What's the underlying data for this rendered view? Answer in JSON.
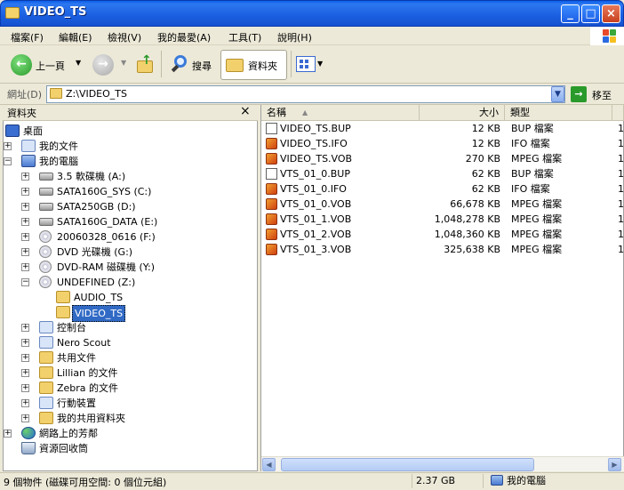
{
  "window": {
    "title": "VIDEO_TS"
  },
  "menu": [
    "檔案(F)",
    "編輯(E)",
    "檢視(V)",
    "我的最愛(A)",
    "工具(T)",
    "說明(H)"
  ],
  "toolbar": {
    "back_label": "上一頁",
    "search_label": "搜尋",
    "folders_label": "資料夾"
  },
  "address": {
    "label": "網址(D)",
    "value": "Z:\\VIDEO_TS",
    "go_label": "移至"
  },
  "left_pane": {
    "title": "資料夾",
    "close": "×"
  },
  "tree": [
    {
      "label": "桌面",
      "icon": "desktop-icon",
      "expander": ""
    },
    {
      "label": "我的文件",
      "icon": "my-documents-icon",
      "expander": "+"
    },
    {
      "label": "我的電腦",
      "icon": "my-computer-icon",
      "expander": "−"
    },
    {
      "label": "3.5 軟碟機 (A:)",
      "icon": "floppy-drive-icon",
      "expander": "+"
    },
    {
      "label": "SATA160G_SYS (C:)",
      "icon": "hard-drive-icon",
      "expander": "+"
    },
    {
      "label": "SATA250GB (D:)",
      "icon": "hard-drive-icon",
      "expander": "+"
    },
    {
      "label": "SATA160G_DATA (E:)",
      "icon": "hard-drive-icon",
      "expander": "+"
    },
    {
      "label": "20060328_0616 (F:)",
      "icon": "cd-drive-icon",
      "expander": "+"
    },
    {
      "label": "DVD 光碟機 (G:)",
      "icon": "dvd-drive-icon",
      "expander": "+"
    },
    {
      "label": "DVD-RAM 磁碟機 (Y:)",
      "icon": "dvd-ram-drive-icon",
      "expander": "+"
    },
    {
      "label": "UNDEFINED (Z:)",
      "icon": "dvd-disc-icon",
      "expander": "−"
    },
    {
      "label": "AUDIO_TS",
      "icon": "folder-icon",
      "expander": ""
    },
    {
      "label": "VIDEO_TS",
      "icon": "folder-open-icon",
      "expander": ""
    },
    {
      "label": "控制台",
      "icon": "control-panel-icon",
      "expander": "+"
    },
    {
      "label": "Nero Scout",
      "icon": "nero-scout-icon",
      "expander": "+"
    },
    {
      "label": "共用文件",
      "icon": "folder-icon",
      "expander": "+"
    },
    {
      "label": "Lillian 的文件",
      "icon": "folder-icon",
      "expander": "+"
    },
    {
      "label": "Zebra 的文件",
      "icon": "folder-icon",
      "expander": "+"
    },
    {
      "label": "行動裝置",
      "icon": "mobile-device-icon",
      "expander": "+"
    },
    {
      "label": "我的共用資料夾",
      "icon": "shared-folder-icon",
      "expander": "+"
    },
    {
      "label": "網路上的芳鄰",
      "icon": "network-icon",
      "expander": "+"
    },
    {
      "label": "資源回收筒",
      "icon": "recycle-bin-icon",
      "expander": ""
    }
  ],
  "columns": {
    "name": "名稱",
    "sort": "▲",
    "size": "大小",
    "type": "類型"
  },
  "files": [
    {
      "name": "VIDEO_TS.BUP",
      "size": "12 KB",
      "type": "BUP 檔案",
      "kind": "bup",
      "extra": "1"
    },
    {
      "name": "VIDEO_TS.IFO",
      "size": "12 KB",
      "type": "IFO 檔案",
      "kind": "vob",
      "extra": "1"
    },
    {
      "name": "VIDEO_TS.VOB",
      "size": "270 KB",
      "type": "MPEG 檔案",
      "kind": "vob",
      "extra": "1"
    },
    {
      "name": "VTS_01_0.BUP",
      "size": "62 KB",
      "type": "BUP 檔案",
      "kind": "bup",
      "extra": "1"
    },
    {
      "name": "VTS_01_0.IFO",
      "size": "62 KB",
      "type": "IFO 檔案",
      "kind": "vob",
      "extra": "1"
    },
    {
      "name": "VTS_01_0.VOB",
      "size": "66,678 KB",
      "type": "MPEG 檔案",
      "kind": "vob",
      "extra": "1"
    },
    {
      "name": "VTS_01_1.VOB",
      "size": "1,048,278 KB",
      "type": "MPEG 檔案",
      "kind": "vob",
      "extra": "1"
    },
    {
      "name": "VTS_01_2.VOB",
      "size": "1,048,360 KB",
      "type": "MPEG 檔案",
      "kind": "vob",
      "extra": "1"
    },
    {
      "name": "VTS_01_3.VOB",
      "size": "325,638 KB",
      "type": "MPEG 檔案",
      "kind": "vob",
      "extra": "1"
    }
  ],
  "status": {
    "items": "9 個物件 (磁碟可用空間: 0 個位元組)",
    "size": "2.37 GB",
    "location": "我的電腦"
  }
}
